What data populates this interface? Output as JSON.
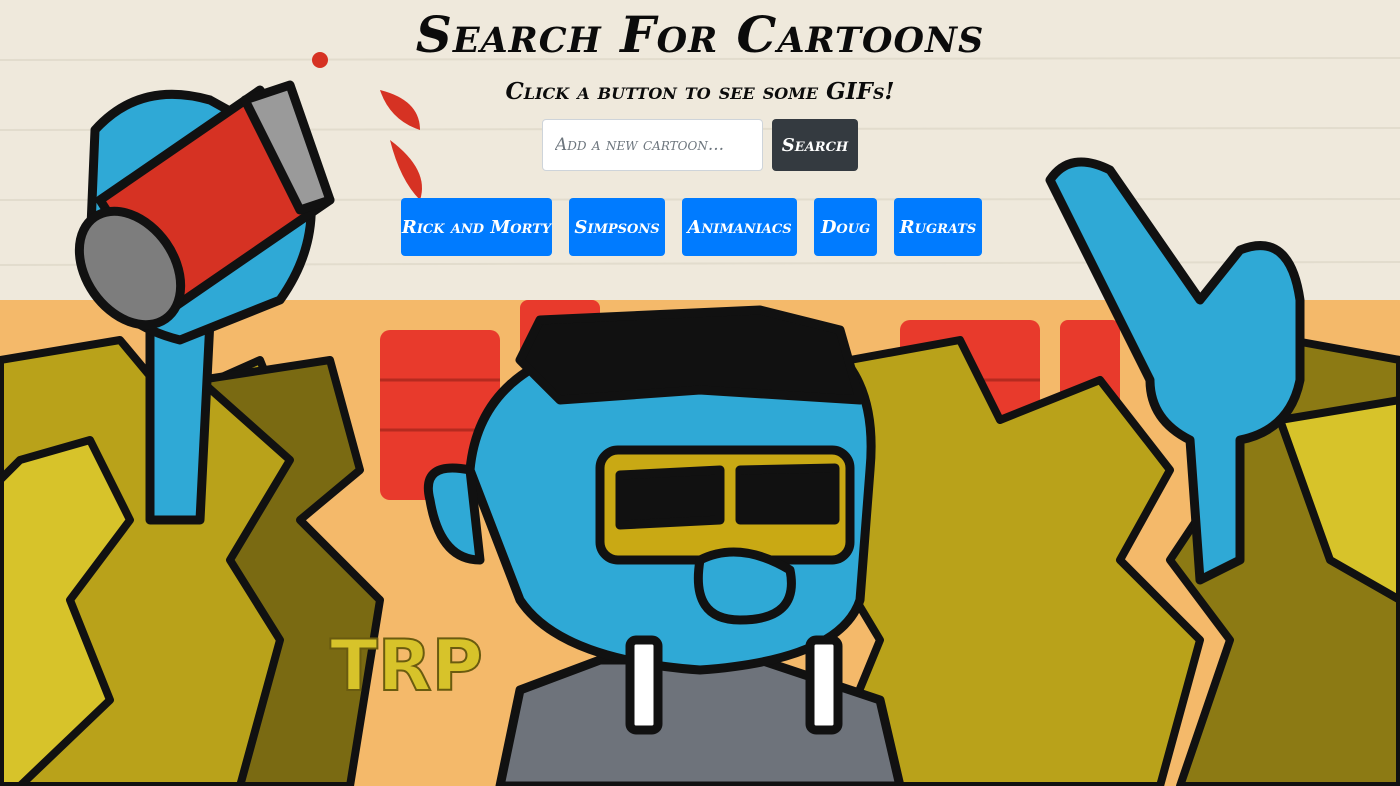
{
  "header": {
    "title": "Search For Cartoons",
    "subtitle": "Click a button to see some GIFs!"
  },
  "search": {
    "placeholder": "Add a new cartoon...",
    "value": "",
    "button_label": "Search"
  },
  "cartoon_buttons": [
    {
      "label": "Rick and Morty"
    },
    {
      "label": "Simpsons"
    },
    {
      "label": "Animaniacs"
    },
    {
      "label": "Doug"
    },
    {
      "label": "Rugrats"
    }
  ],
  "colors": {
    "primary_button": "#007bff",
    "dark_button": "#343a40",
    "title_text": "#0b0b0b"
  }
}
